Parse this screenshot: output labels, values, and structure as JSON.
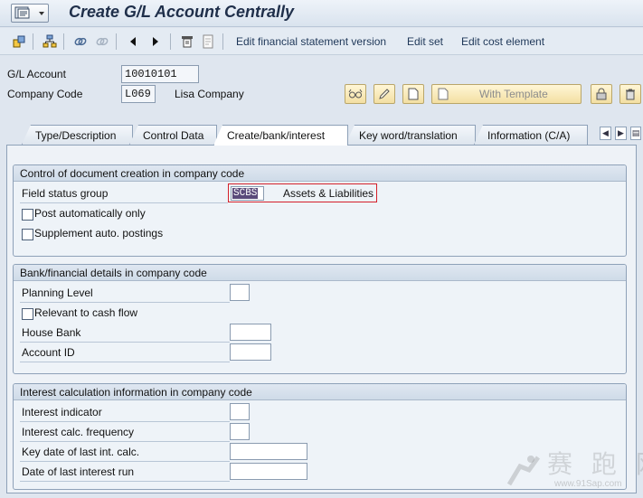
{
  "title": "Create G/L Account Centrally",
  "toolbar": {
    "items": [
      "Edit financial statement version",
      "Edit set",
      "Edit cost element"
    ]
  },
  "header": {
    "gl_account_label": "G/L Account",
    "gl_account_value": "10010101",
    "company_code_label": "Company Code",
    "company_code_value": "L069",
    "company_name": "Lisa Company",
    "with_template_label": "With Template"
  },
  "tabs": [
    "Type/Description",
    "Control Data",
    "Create/bank/interest",
    "Key word/translation",
    "Information (C/A)"
  ],
  "active_tab": "Create/bank/interest",
  "group1": {
    "title": "Control of document creation in company code",
    "field_status_group_label": "Field status group",
    "field_status_group_value": "SCBS",
    "field_status_group_desc": "Assets & Liabilities",
    "post_auto_label": "Post automatically only",
    "post_auto_checked": false,
    "supplement_label": "Supplement auto. postings",
    "supplement_checked": false
  },
  "group2": {
    "title": "Bank/financial details in company code",
    "planning_level_label": "Planning Level",
    "relevant_cash_label": "Relevant to cash flow",
    "relevant_cash_checked": false,
    "house_bank_label": "House Bank",
    "account_id_label": "Account ID"
  },
  "group3": {
    "title": "Interest calculation information in company code",
    "interest_indicator_label": "Interest indicator",
    "interest_freq_label": "Interest calc. frequency",
    "key_date_label": "Key date of last int. calc.",
    "date_last_run_label": "Date of last interest run"
  },
  "watermark": {
    "text": "赛 跑 网",
    "url": "www.91Sap.com"
  },
  "colors": {
    "highlight_border": "#d4202a",
    "selected_text_bg": "#5a4a7a"
  }
}
